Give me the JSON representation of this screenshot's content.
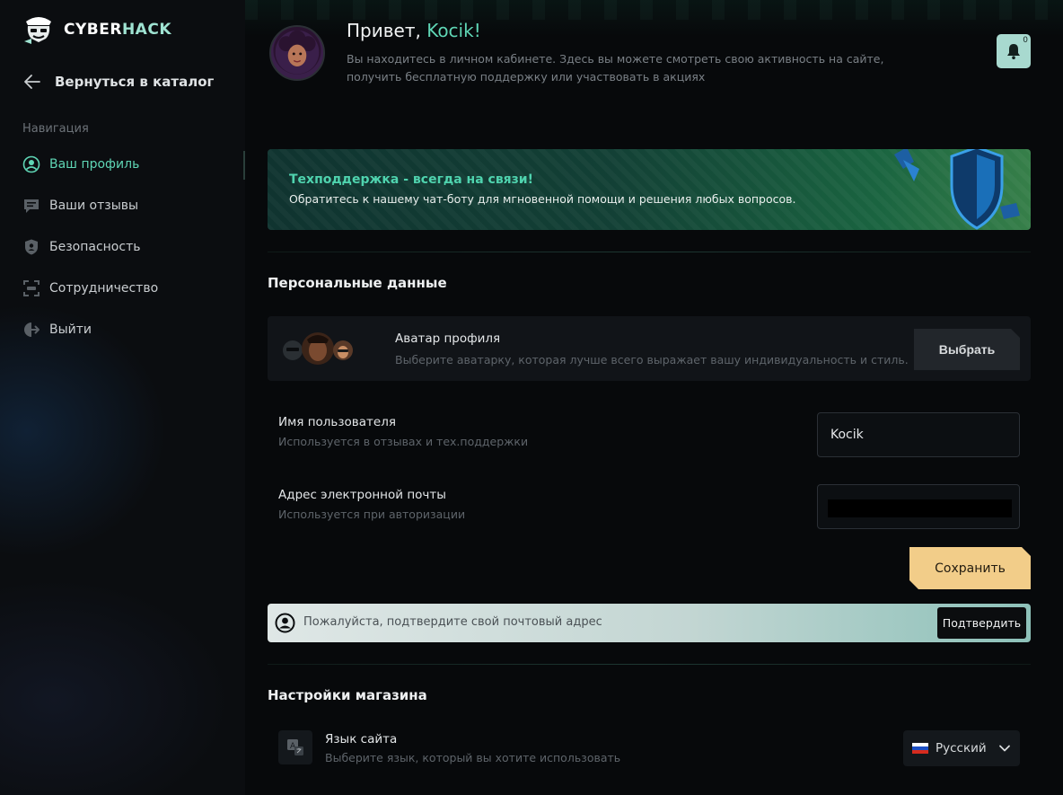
{
  "brand": {
    "name_part1": "CYBER",
    "name_part2": "HACK"
  },
  "sidebar": {
    "back_label": "Вернуться в каталог",
    "nav_heading": "Навигация",
    "items": [
      {
        "label": "Ваш профиль",
        "icon": "user-circle-icon"
      },
      {
        "label": "Ваши отзывы",
        "icon": "chat-bubble-icon"
      },
      {
        "label": "Безопасность",
        "icon": "shield-icon"
      },
      {
        "label": "Сотрудничество",
        "icon": "handshake-icon"
      },
      {
        "label": "Выйти",
        "icon": "logout-icon"
      }
    ]
  },
  "header": {
    "greeting_prefix": "Привет, ",
    "username": "Kocik!",
    "subtitle": "Вы находитесь в личном кабинете. Здесь вы можете смотреть свою активность на сайте, получить бесплатную поддержку или участвовать в акциях",
    "notification_count": "0"
  },
  "banner": {
    "title": "Техподдержка - всегда на связи!",
    "text": "Обратитесь к нашему чат-боту для мгновенной помощи и решения любых вопросов."
  },
  "personal": {
    "section_title": "Персональные данные",
    "avatar_title": "Аватар профиля",
    "avatar_sub": "Выберите аватарку, которая лучше всего выражает вашу индивидуальность и стиль.",
    "choose_label": "Выбрать",
    "username_label": "Имя пользователя",
    "username_sub": "Используется в отзывах и тех.поддержки",
    "username_value": "Kocik",
    "email_label": "Адрес электронной почты",
    "email_sub": "Используется при авторизации",
    "email_value": "",
    "save_label": "Сохранить"
  },
  "verify": {
    "text": "Пожалуйста, подтвердите свой почтовый адрес",
    "button_label": "Подтвердить"
  },
  "shop": {
    "section_title": "Настройки магазина",
    "lang_title": "Язык сайта",
    "lang_sub": "Выберите язык, который вы хотите использовать",
    "lang_value": "Русский"
  },
  "colors": {
    "accent": "#5fd6b5",
    "save_button": "#f2cd89",
    "bell_bg": "#a8d9cf"
  }
}
